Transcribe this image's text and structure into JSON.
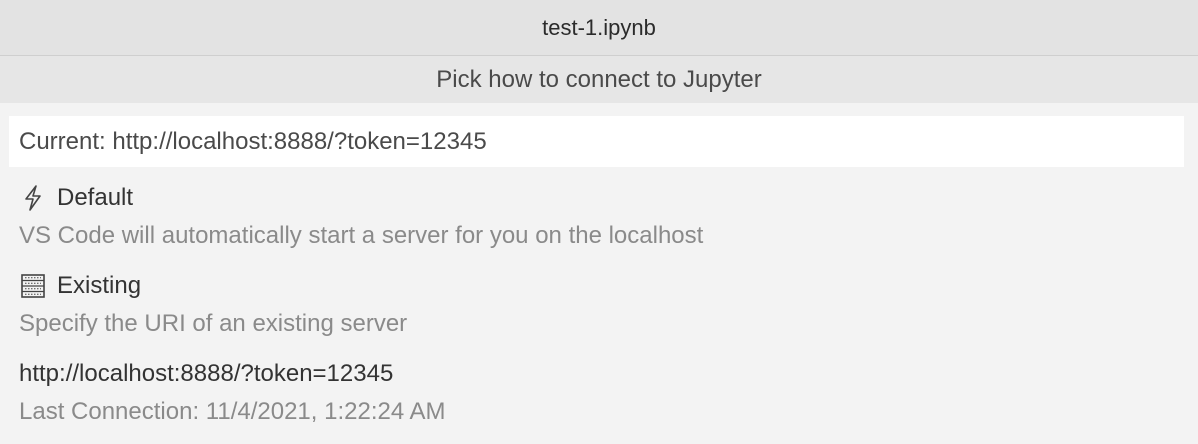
{
  "window": {
    "title": "test-1.ipynb"
  },
  "quickpick": {
    "title": "Pick how to connect to Jupyter",
    "current": "Current: http://localhost:8888/?token=12345",
    "items": [
      {
        "icon": "lightning-bolt-icon",
        "label": "Default",
        "detail": "VS Code will automatically start a server for you on the localhost"
      },
      {
        "icon": "server-icon",
        "label": "Existing",
        "detail": "Specify the URI of an existing server"
      },
      {
        "label": "http://localhost:8888/?token=12345",
        "detail": "Last Connection: 11/4/2021, 1:22:24 AM"
      }
    ]
  }
}
